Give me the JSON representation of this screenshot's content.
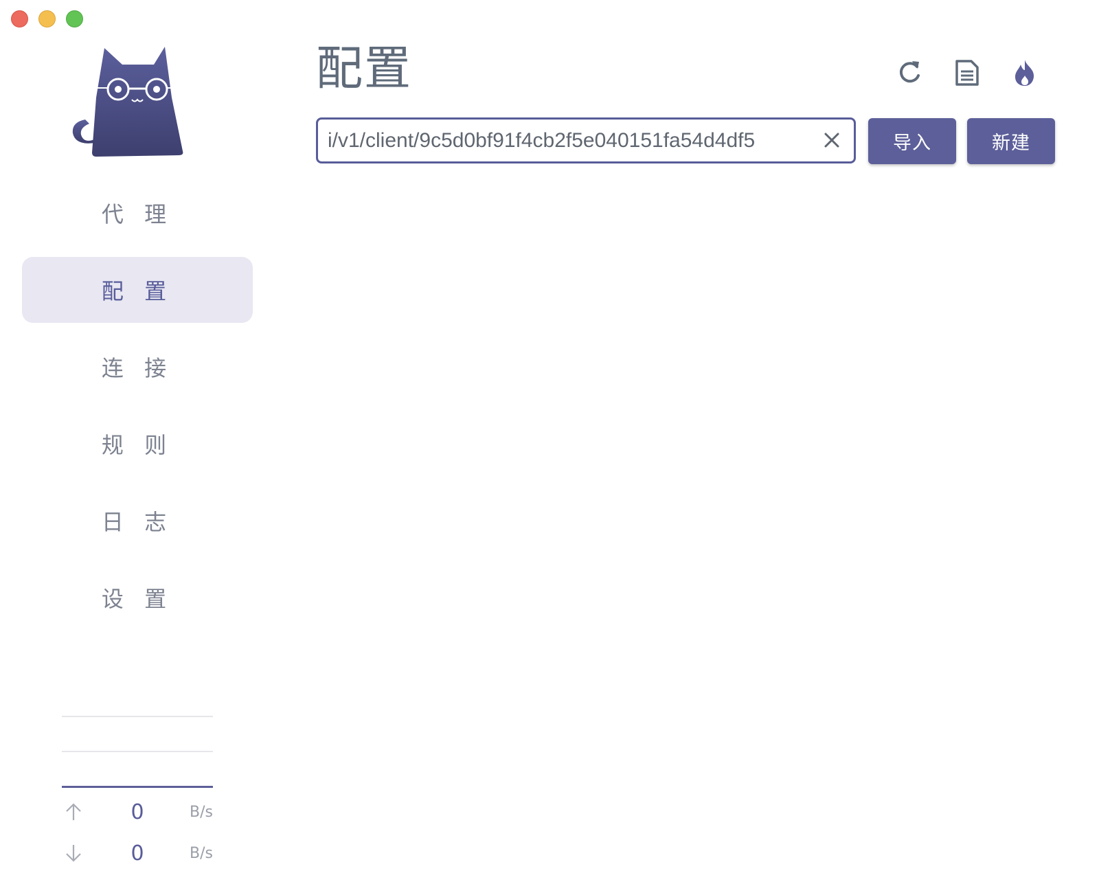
{
  "window": {
    "controls": [
      "close",
      "minimize",
      "maximize"
    ]
  },
  "sidebar": {
    "logo_icon": "cat-logo-icon",
    "items": [
      {
        "label": "代 理",
        "active": false
      },
      {
        "label": "配 置",
        "active": true
      },
      {
        "label": "连 接",
        "active": false
      },
      {
        "label": "规 则",
        "active": false
      },
      {
        "label": "日 志",
        "active": false
      },
      {
        "label": "设 置",
        "active": false
      }
    ],
    "traffic": {
      "upload": {
        "value": "0",
        "unit": "B/s",
        "icon": "arrow-up-icon"
      },
      "download": {
        "value": "0",
        "unit": "B/s",
        "icon": "arrow-down-icon"
      }
    }
  },
  "header": {
    "title": "配置",
    "icons": [
      "reload-icon",
      "document-icon",
      "fire-icon"
    ]
  },
  "url_input": {
    "value": "i/v1/client/9c5d0bf91f4cb2f5e040151fa54d4df5",
    "clear_icon": "close-icon"
  },
  "buttons": {
    "import_label": "导入",
    "create_label": "新建"
  },
  "colors": {
    "accent": "#5c5f99",
    "active_nav_bg": "#e8e7f2",
    "nav_text": "#7d8290",
    "title_text": "#5f6b7a"
  }
}
